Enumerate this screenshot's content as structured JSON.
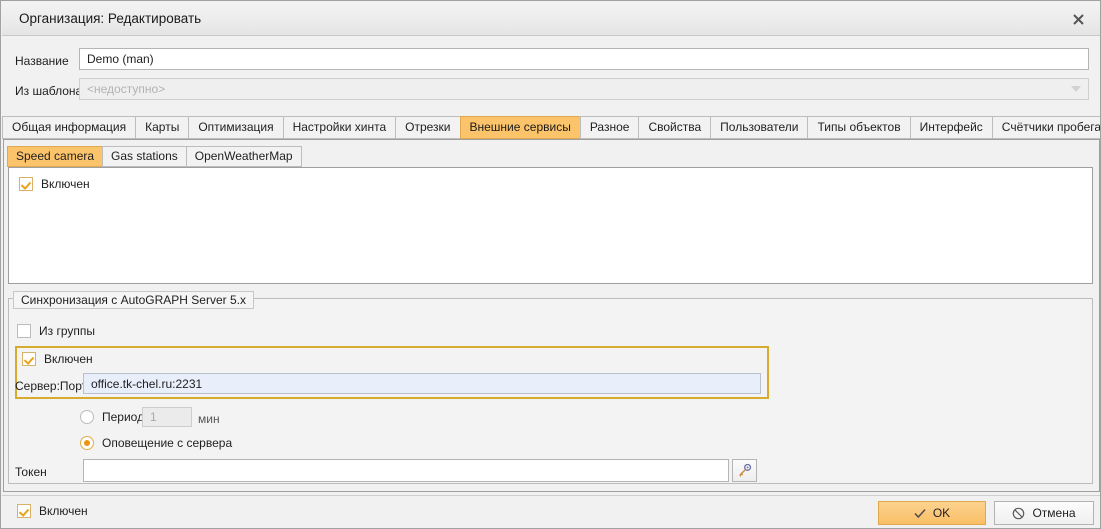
{
  "window": {
    "title": "Организация: Редактировать",
    "close_icon": "close-icon"
  },
  "form": {
    "name_label": "Название",
    "name_value": "Demo (man)",
    "template_label": "Из шаблона",
    "template_value": "<недоступно>",
    "template_arrow_icon": "chevron-down-icon"
  },
  "tabs": [
    {
      "label": "Общая информация",
      "active": false
    },
    {
      "label": "Карты",
      "active": false
    },
    {
      "label": "Оптимизация",
      "active": false
    },
    {
      "label": "Настройки хинта",
      "active": false
    },
    {
      "label": "Отрезки",
      "active": false
    },
    {
      "label": "Внешние сервисы",
      "active": true
    },
    {
      "label": "Разное",
      "active": false
    },
    {
      "label": "Свойства",
      "active": false
    },
    {
      "label": "Пользователи",
      "active": false
    },
    {
      "label": "Типы объектов",
      "active": false
    },
    {
      "label": "Интерфейс",
      "active": false
    },
    {
      "label": "Счётчики пробега и моточасов",
      "active": false
    }
  ],
  "subtabs": [
    {
      "label": "Speed camera",
      "active": true
    },
    {
      "label": "Gas stations",
      "active": false
    },
    {
      "label": "OpenWeatherMap",
      "active": false
    }
  ],
  "service": {
    "enabled_label": "Включен",
    "enabled_checked": true
  },
  "sync_group": {
    "legend": "Синхронизация с AutoGRAPH Server 5.x",
    "from_group_label": "Из группы",
    "from_group_checked": false,
    "enabled_label": "Включен",
    "enabled_checked": true,
    "server_label": "Сервер:Порт",
    "server_value": "office.tk-chel.ru:2231",
    "period_label": "Период",
    "period_value": "1",
    "period_unit": "мин",
    "period_selected": false,
    "notify_label": "Оповещение с сервера",
    "notify_selected": true,
    "token_label": "Токен",
    "token_value": "",
    "token_button_icon": "key-icon"
  },
  "footer": {
    "enabled_label": "Включен",
    "enabled_checked": true,
    "ok_label": "OK",
    "ok_icon": "check-icon",
    "cancel_label": "Отмена",
    "cancel_icon": "ban-icon"
  },
  "colors": {
    "accent": "#fcc46a",
    "highlight_border": "#d6ab2e",
    "check_mark": "#e8a317",
    "radio_fill": "#f0930e",
    "field_focus_bg": "#e9eefb"
  }
}
